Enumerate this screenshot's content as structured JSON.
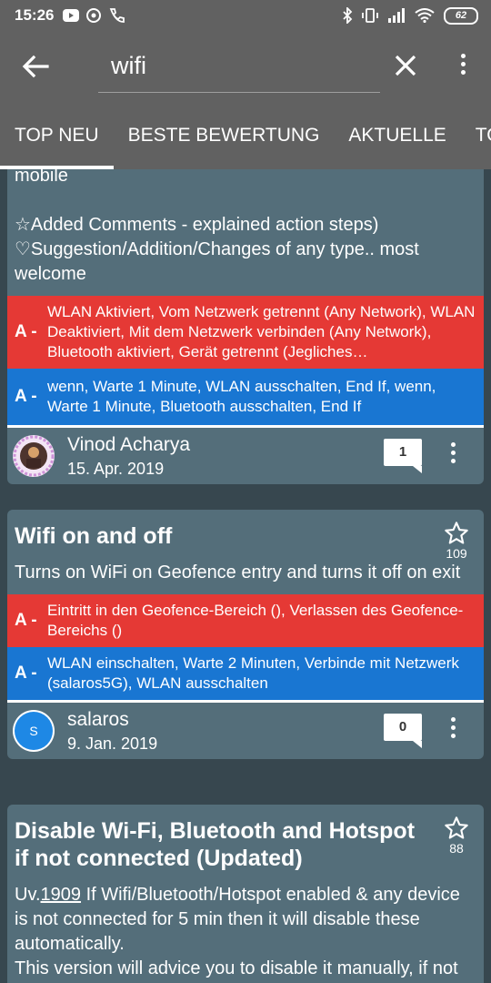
{
  "status_bar": {
    "time": "15:26",
    "battery": "62"
  },
  "search": {
    "query": "wifi"
  },
  "tabs": [
    {
      "label": "TOP NEU",
      "active": true
    },
    {
      "label": "BESTE BEWERTUNG",
      "active": false
    },
    {
      "label": "AKTUELLE",
      "active": false
    },
    {
      "label": "TO",
      "active": false
    }
  ],
  "cards": [
    {
      "desc_lines": [
        "mobile",
        "",
        "☆Added Comments - explained action steps)",
        "♡Suggestion/Addition/Changes of any type.. most welcome"
      ],
      "trigger_label": "A -",
      "trigger_text": "WLAN Aktiviert, Vom Netzwerk getrennt (Any Network), WLAN Deaktiviert, Mit dem Netzwerk verbinden (Any Network), Bluetooth aktiviert, Gerät getrennt (Jegliches…",
      "action_label": "A -",
      "action_text": "wenn, Warte 1 Minute, WLAN ausschalten, End If, wenn, Warte 1 Minute, Bluetooth ausschalten, End If",
      "author": "Vinod Acharya",
      "date": "15. Apr. 2019",
      "comments": "1"
    },
    {
      "title": "Wifi on and off",
      "stars": "109",
      "desc": "Turns on WiFi on Geofence entry and turns it off on exit",
      "trigger_label": "A -",
      "trigger_text": "Eintritt in den Geofence-Bereich (), Verlassen des Geofence-Bereichs ()",
      "action_label": "A -",
      "action_text": "WLAN einschalten, Warte 2 Minuten, Verbinde mit Netzwerk (salaros5G), WLAN ausschalten",
      "author": "salaros",
      "avatar_letter": "S",
      "date": "9. Jan. 2019",
      "comments": "0"
    },
    {
      "title": "Disable Wi-Fi, Bluetooth and Hotspot if not connected (Updated)",
      "stars": "88",
      "desc_prefix": "Uv.",
      "desc_link": "1909",
      "desc_rest": " If Wifi/Bluetooth/Hotspot enabled & any device is not connected for 5 min then it will disable these automatically.",
      "desc2": "This version will advice you to disable it manually, if not turned off automatically (only for some devices"
    }
  ],
  "colors": {
    "trigger": "#e53935",
    "action": "#1976d2",
    "card": "#546e7a",
    "appbar": "#616161"
  }
}
